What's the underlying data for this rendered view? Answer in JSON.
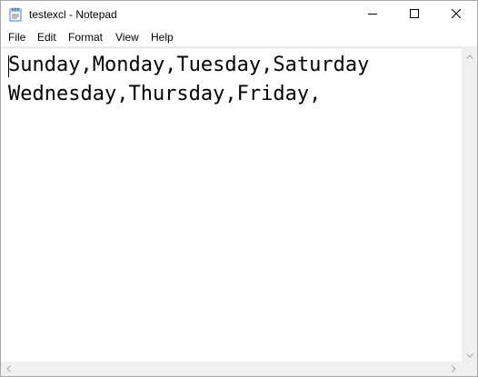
{
  "window": {
    "title": "testexcl - Notepad",
    "icon": "notepad-icon"
  },
  "caption_buttons": {
    "minimize": "minimize-icon",
    "maximize": "maximize-icon",
    "close": "close-icon"
  },
  "menu": {
    "items": [
      {
        "label": "File"
      },
      {
        "label": "Edit"
      },
      {
        "label": "Format"
      },
      {
        "label": "View"
      },
      {
        "label": "Help"
      }
    ]
  },
  "editor": {
    "lines": [
      "Sunday,Monday,Tuesday,Saturday",
      "Wednesday,Thursday,Friday,"
    ]
  },
  "colors": {
    "background": "#ffffff",
    "scrollbar": "#f0f0f0",
    "text": "#000000"
  }
}
